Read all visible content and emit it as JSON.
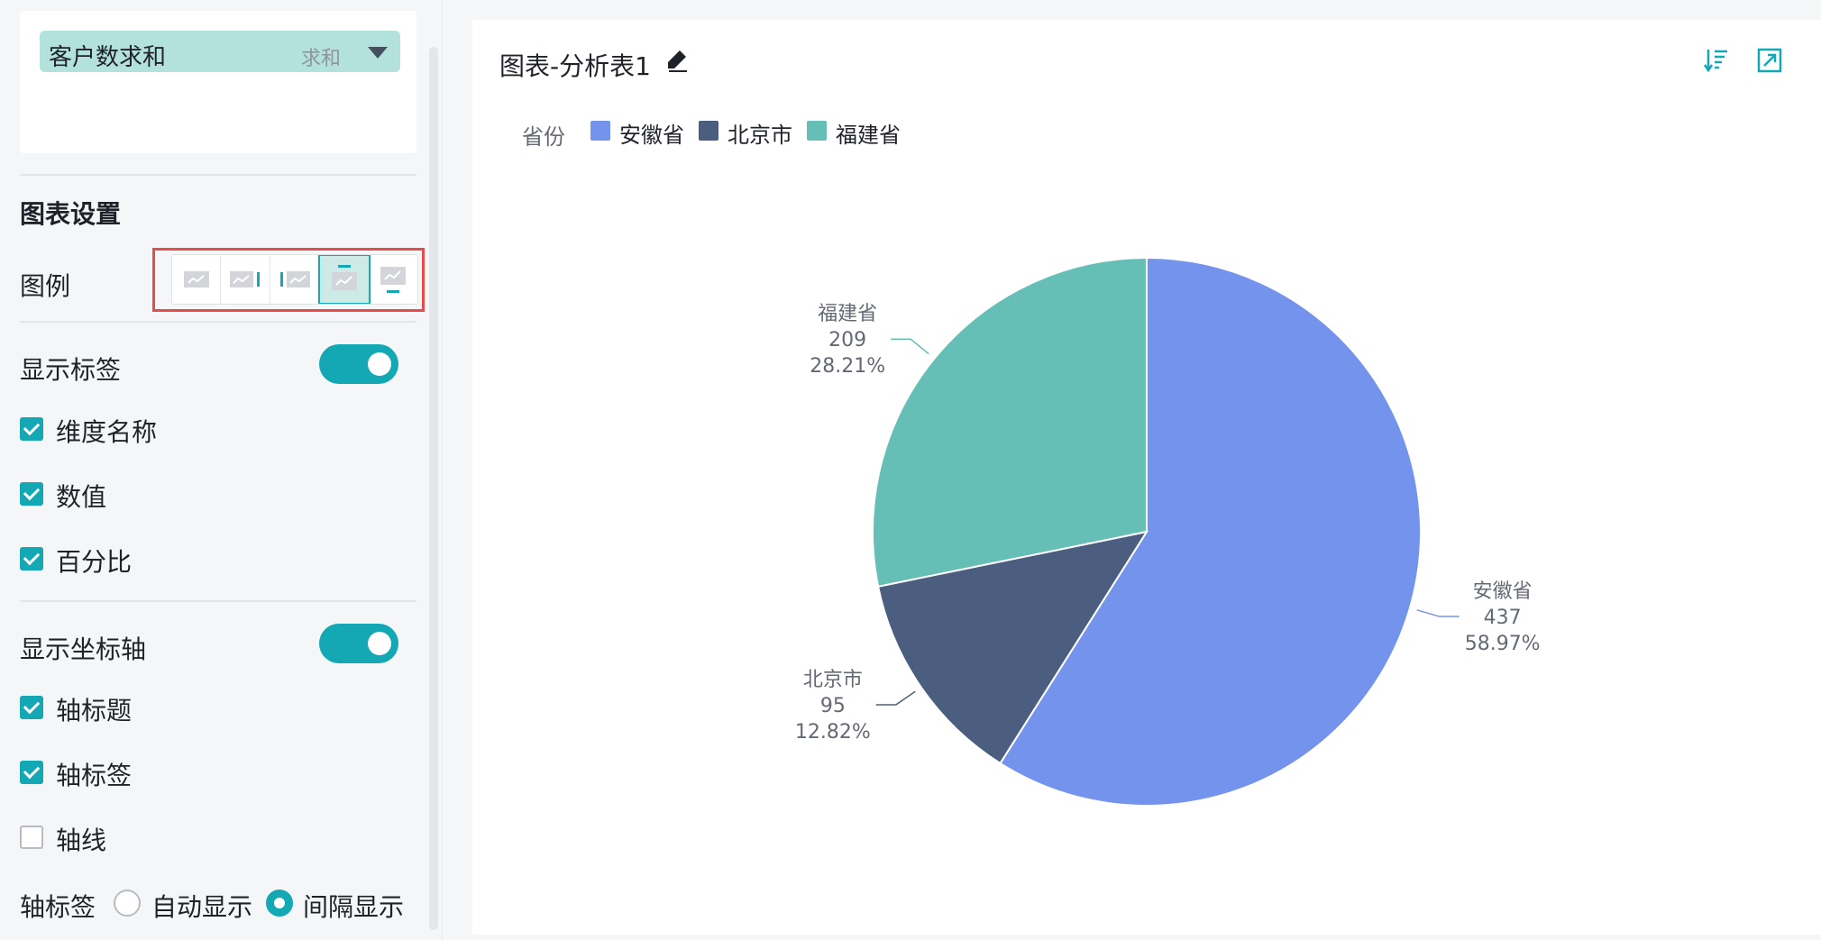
{
  "field": {
    "name": "客户数求和",
    "aggregation": "求和"
  },
  "settings": {
    "section_title": "图表设置",
    "legend_label": "图例",
    "legend_options": [
      "none",
      "right",
      "left",
      "top",
      "bottom"
    ],
    "legend_selected": "top",
    "show_labels": "显示标签",
    "show_labels_on": true,
    "dimension_name": "维度名称",
    "value": "数值",
    "percent": "百分比",
    "show_axis": "显示坐标轴",
    "show_axis_on": true,
    "axis_title": "轴标题",
    "axis_labels": "轴标签",
    "axis_line": "轴线",
    "axis_label_mode": "轴标签",
    "auto_show": "自动显示",
    "interval_show": "间隔显示",
    "selected_mode": "间隔显示"
  },
  "chart_card": {
    "title": "图表-分析表1"
  },
  "chart_data": {
    "type": "pie",
    "legend_title": "省份",
    "categories": [
      "安徽省",
      "北京市",
      "福建省"
    ],
    "values": [
      437,
      95,
      209
    ],
    "percents": [
      "58.97%",
      "12.82%",
      "28.21%"
    ],
    "colors": [
      "#7493ec",
      "#4b5e7f",
      "#66bfb6"
    ],
    "legend_position": "top-left"
  }
}
